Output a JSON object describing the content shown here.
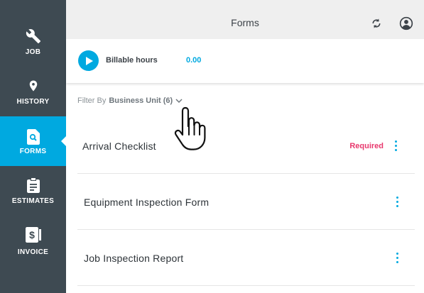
{
  "sidebar": {
    "items": [
      {
        "label": "JOB",
        "icon": "wrench-icon",
        "active": false
      },
      {
        "label": "HISTORY",
        "icon": "map-pin-icon",
        "active": false
      },
      {
        "label": "FORMS",
        "icon": "form-search-icon",
        "active": true
      },
      {
        "label": "ESTIMATES",
        "icon": "clipboard-icon",
        "active": false
      },
      {
        "label": "INVOICE",
        "icon": "invoice-icon",
        "active": false
      }
    ]
  },
  "header": {
    "title": "Forms",
    "refresh_icon": "refresh-icon",
    "account_icon": "user-circle-icon"
  },
  "timer": {
    "label": "Billable hours",
    "value": "0.00"
  },
  "filter": {
    "prefix": "Filter By",
    "value": "Business Unit (6)"
  },
  "forms": [
    {
      "name": "Arrival Checklist",
      "required_label": "Required"
    },
    {
      "name": "Equipment Inspection Form",
      "required_label": ""
    },
    {
      "name": "Job Inspection Report",
      "required_label": ""
    }
  ],
  "colors": {
    "accent": "#00a9e0",
    "sidebar": "#3e4a52",
    "required": "#e8386d"
  }
}
